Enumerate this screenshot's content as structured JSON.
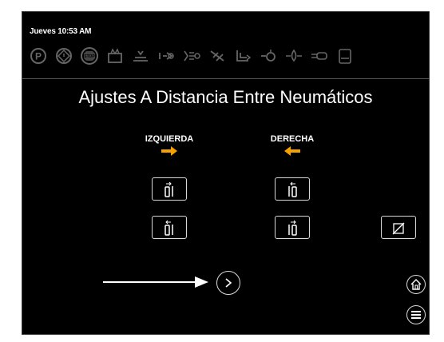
{
  "status": {
    "datetime": "Jueves 10:53 AM"
  },
  "status_icons": [
    "parking-icon",
    "warning-diamond-icon",
    "stop-icon",
    "tank-icon",
    "level-icon",
    "lift-icon",
    "spray-icon",
    "no-spray-icon",
    "dump-icon",
    "hose-icon",
    "drop-icon",
    "tube-icon",
    "panel-icon"
  ],
  "title": "Ajustes A Distancia Entre Neumáticos",
  "left_column": {
    "label": "IZQUIERDA",
    "arrow_color": "#f5a100",
    "arrow_direction": "right"
  },
  "right_column": {
    "label": "DERECHA",
    "arrow_color": "#f5a100",
    "arrow_direction": "left"
  }
}
